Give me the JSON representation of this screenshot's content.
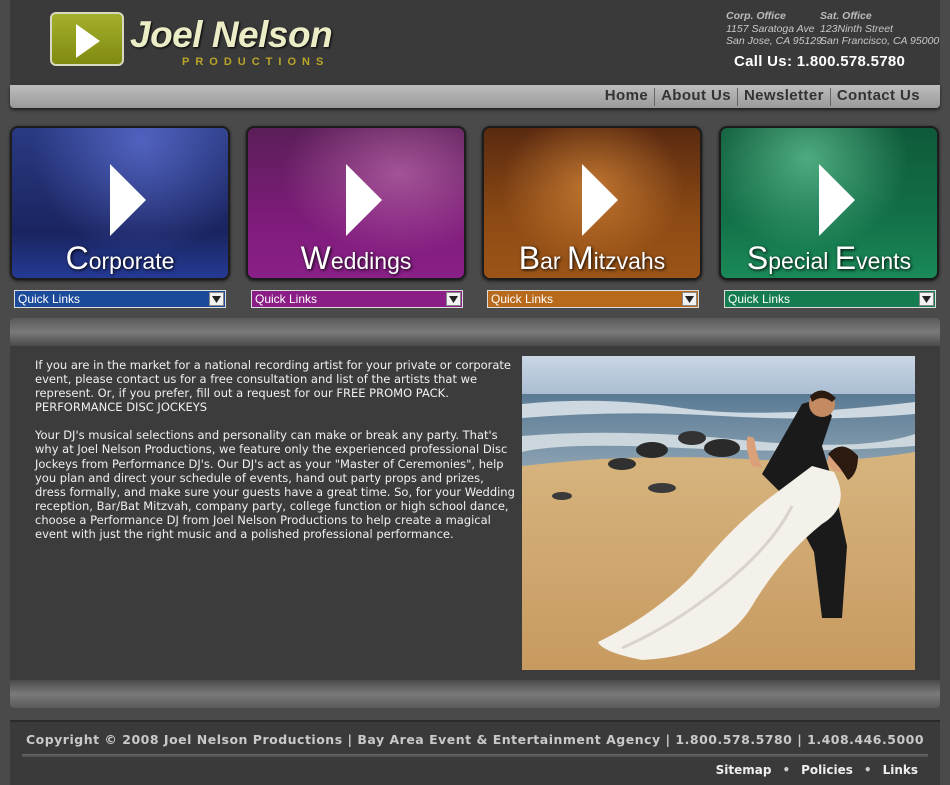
{
  "brand": {
    "name": "Joel Nelson",
    "sub": "PRODUCTIONS"
  },
  "offices": {
    "corp": {
      "title": "Corp. Office",
      "line1": "1157 Saratoga Ave",
      "line2": "San Jose, CA 95129"
    },
    "sat": {
      "title": "Sat. Office",
      "line1": "123Ninth Street",
      "line2": "San Francisco,  CA 95000"
    }
  },
  "call_us": "Call Us: 1.800.578.5780",
  "nav": [
    "Home",
    "About Us",
    "Newsletter",
    "Contact Us"
  ],
  "categories": [
    {
      "cap1": "C",
      "rest1": "orporate",
      "cap2": "",
      "rest2": "",
      "quick": "Quick Links",
      "color": "#1c4a9a"
    },
    {
      "cap1": "W",
      "rest1": "eddings",
      "cap2": "",
      "rest2": "",
      "quick": "Quick Links",
      "color": "#8a1e86"
    },
    {
      "cap1": "B",
      "rest1": "ar ",
      "cap2": "M",
      "rest2": "itzvahs",
      "quick": "Quick Links",
      "color": "#b86a1c"
    },
    {
      "cap1": "S",
      "rest1": "pecial ",
      "cap2": "E",
      "rest2": "vents",
      "quick": "Quick Links",
      "color": "#147c4e"
    }
  ],
  "content": {
    "p1": "If you are in the market for a national recording artist for your private or corporate event, please contact us for a free consultation and list of the artists that we represent. Or, if you prefer, fill out a request for our FREE PROMO PACK. PERFORMANCE DISC JOCKEYS",
    "p2": "Your DJ's musical selections and personality can make or break any party. That's why at Joel Nelson Productions, we feature only the experienced professional Disc Jockeys from Performance DJ's. Our DJ's act as your \"Master of Ceremonies\", help you plan and direct your schedule of events, hand out party props and prizes, dress formally, and make sure your guests have a great time. So, for your Wedding reception, Bar/Bat Mitzvah, company party, college function or high school dance, choose a Performance DJ from Joel Nelson Productions to help create a magical event with just the right music and a polished professional performance."
  },
  "footer": {
    "copyright": "Copyright © 2008 Joel Nelson Productions | Bay Area Event & Entertainment Agency | 1.800.578.5780 | 1.408.446.5000",
    "links": [
      "Sitemap",
      "Policies",
      "Links"
    ]
  }
}
